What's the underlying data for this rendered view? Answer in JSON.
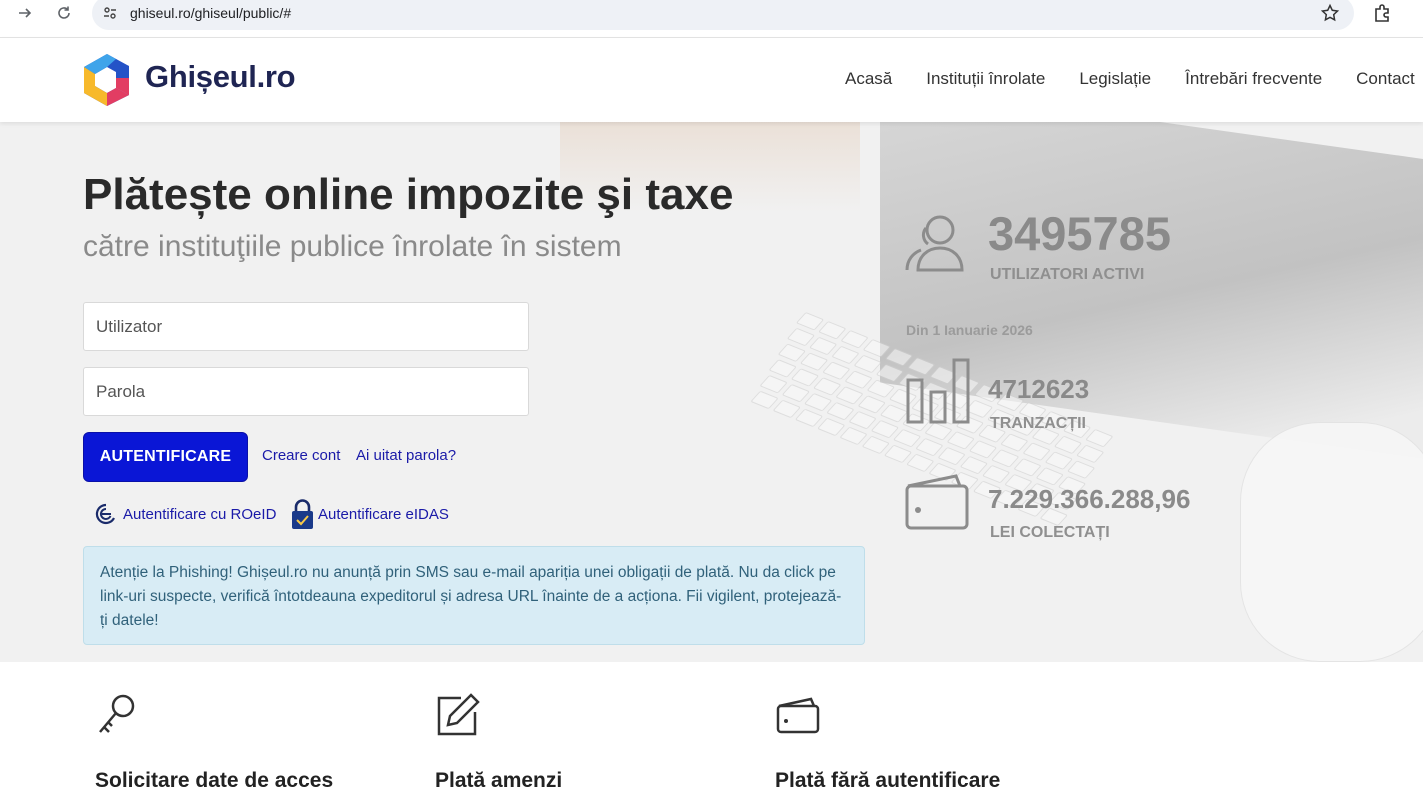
{
  "browser": {
    "url": "ghiseul.ro/ghiseul/public/#"
  },
  "header": {
    "brand": "Ghișeul.ro",
    "nav": [
      "Acasă",
      "Instituții înrolate",
      "Legislație",
      "Întrebări frecvente",
      "Contact"
    ]
  },
  "hero": {
    "title": "Plătește online impozite şi taxe",
    "subtitle": "către instituţiile publice înrolate în sistem"
  },
  "login": {
    "username_placeholder": "Utilizator",
    "password_placeholder": "Parola",
    "submit_label": "AUTENTIFICARE",
    "create_account": "Creare cont",
    "forgot_password": "Ai uitat parola?",
    "roeid_label": "Autentificare cu ROeID",
    "eidas_label": "Autentificare eIDAS"
  },
  "alert": {
    "text": "Atenție la Phishing! Ghișeul.ro nu anunță prin SMS sau e-mail apariția unei obligații de plată. Nu da click pe link-uri suspecte, verifică întotdeauna expeditorul și adresa URL înainte de a acționa. Fii vigilent, protejează-ți datele!"
  },
  "stats": {
    "users_value": "3495785",
    "users_label": "UTILIZATORI ACTIVI",
    "since": "Din 1 Ianuarie 2026",
    "transactions_value": "4712623",
    "transactions_label": "TRANZACȚII",
    "collected_value": "7.229.366.288,96",
    "collected_label": "LEI COLECTAȚI"
  },
  "features": [
    {
      "title": "Solicitare date de acces",
      "icon": "key-icon"
    },
    {
      "title": "Plată amenzi",
      "icon": "edit-icon"
    },
    {
      "title": "Plată fără autentificare",
      "icon": "wallet-icon"
    }
  ],
  "colors": {
    "accent": "#0a16d6",
    "brand_text": "#1f2553",
    "alert_bg": "#d8ecf5"
  }
}
